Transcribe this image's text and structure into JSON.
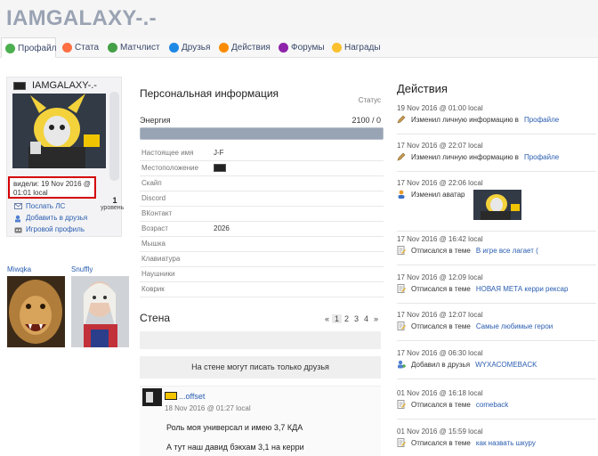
{
  "header": {
    "title": "IAMGALAXY-.-"
  },
  "nav": {
    "tabs": [
      {
        "label": "Профайл",
        "icon": "profile-icon",
        "color": "#4caf50"
      },
      {
        "label": "Стата",
        "icon": "stats-icon",
        "color": "#ff7043"
      },
      {
        "label": "Матчлист",
        "icon": "matchlist-icon",
        "color": "#43a047"
      },
      {
        "label": "Друзья",
        "icon": "friends-icon",
        "color": "#1e88e5"
      },
      {
        "label": "Действия",
        "icon": "actions-icon",
        "color": "#fb8c00"
      },
      {
        "label": "Форумы",
        "icon": "forums-icon",
        "color": "#8e24aa"
      },
      {
        "label": "Награды",
        "icon": "awards-icon",
        "color": "#fbc02d"
      }
    ]
  },
  "profile": {
    "name": "IAMGALAXY-.-",
    "level": "1",
    "level_label": "уровень",
    "seen_line1": "видели: 19 Nov 2016 @",
    "seen_line2": "01:01 local",
    "actions": [
      {
        "label": "Послать ЛС",
        "icon": "mail-icon"
      },
      {
        "label": "Добавить в друзья",
        "icon": "add-friend-icon"
      },
      {
        "label": "Игровой профиль",
        "icon": "game-profile-icon"
      }
    ]
  },
  "friends": [
    {
      "name": "Miwqka"
    },
    {
      "name": "Snuffly"
    }
  ],
  "personal": {
    "title": "Персональная информация",
    "status_label": "Статус",
    "energy_label": "Энергия",
    "energy_value": "2100 / 0",
    "energy_fraction": 1.0,
    "rows": [
      {
        "label": "Настоящее имя",
        "value": "J-F"
      },
      {
        "label": "Местоположение",
        "value": ""
      },
      {
        "label": "Скайп",
        "value": ""
      },
      {
        "label": "Discord",
        "value": ""
      },
      {
        "label": "ВКонтакт",
        "value": ""
      },
      {
        "label": "Возраст",
        "value": "2026"
      },
      {
        "label": "Мышка",
        "value": ""
      },
      {
        "label": "Клавиатура",
        "value": ""
      },
      {
        "label": "Наушники",
        "value": ""
      },
      {
        "label": "Коврик",
        "value": ""
      }
    ]
  },
  "wall": {
    "title": "Стена",
    "pages": [
      "«",
      "1",
      "2",
      "3",
      "4",
      "»"
    ],
    "active_page": "1",
    "notice": "На стене могут писать только друзья",
    "post": {
      "author": "...offset",
      "date": "18 Nov 2016 @ 01:27 local",
      "lines": [
        "Роль моя универсал и имею 3,7 КДА",
        "А тут наш давид бэкхам 3,1 на керри"
      ]
    }
  },
  "actions": {
    "title": "Действия",
    "items": [
      {
        "date": "19 Nov 2016 @ 01:00 local",
        "icon": "pencil-icon",
        "text": "Изменил личную информацию в",
        "link": "Профайле"
      },
      {
        "date": "17 Nov 2016 @ 22:07 local",
        "icon": "pencil-icon",
        "text": "Изменил личную информацию в",
        "link": "Профайле"
      },
      {
        "date": "17 Nov 2016 @ 22:06 local",
        "icon": "user-icon",
        "text": "Изменил аватар",
        "link": ""
      },
      {
        "date": "17 Nov 2016 @ 16:42 local",
        "icon": "note-icon",
        "text": "Отписался в теме",
        "link": "В игре все лагает ("
      },
      {
        "date": "17 Nov 2016 @ 12:09 local",
        "icon": "note-icon",
        "text": "Отписался в теме",
        "link": "НОВАЯ МЕТА керри рексар"
      },
      {
        "date": "17 Nov 2016 @ 12:07 local",
        "icon": "note-icon",
        "text": "Отписался в теме",
        "link": "Самые любимые герои"
      },
      {
        "date": "17 Nov 2016 @ 06:30 local",
        "icon": "add-friend-icon",
        "text": "Добавил в друзья",
        "link": "WYXACOMEBACK"
      },
      {
        "date": "01 Nov 2016 @ 16:18 local",
        "icon": "note-icon",
        "text": "Отписался в теме",
        "link": "comeback"
      },
      {
        "date": "01 Nov 2016 @ 15:59 local",
        "icon": "note-icon",
        "text": "Отписался в теме",
        "link": "как назвать шкуру"
      }
    ]
  },
  "colors": {
    "link": "#2a5db0",
    "highlight_border": "#d40000",
    "title_gray": "#9aa3b3"
  }
}
